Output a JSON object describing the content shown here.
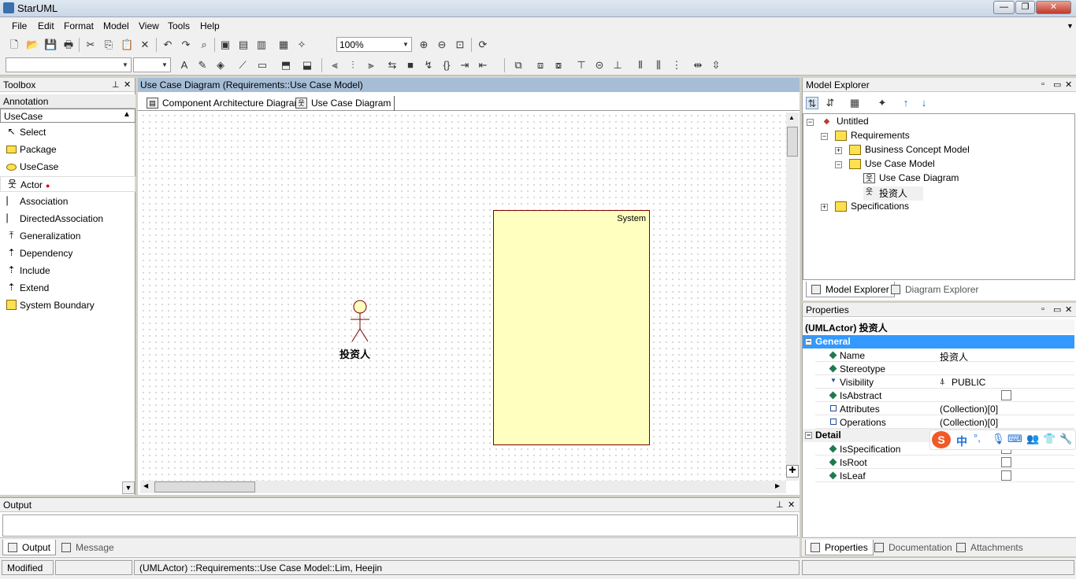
{
  "app": {
    "title": "StarUML"
  },
  "menu": [
    "File",
    "Edit",
    "Format",
    "Model",
    "View",
    "Tools",
    "Help"
  ],
  "toolbar": {
    "zoom": "100%"
  },
  "toolbox": {
    "title": "Toolbox",
    "categories": [
      "Annotation",
      "UseCase"
    ],
    "items": [
      "Select",
      "Package",
      "UseCase",
      "Actor",
      "Association",
      "DirectedAssociation",
      "Generalization",
      "Dependency",
      "Include",
      "Extend",
      "System Boundary"
    ]
  },
  "diagram": {
    "header": "Use Case Diagram (Requirements::Use Case Model)",
    "tabs": [
      "Component Architecture Diagram",
      "Use Case Diagram"
    ],
    "system_label": "System",
    "actor_name": "投资人"
  },
  "output": {
    "title": "Output",
    "tabs": [
      "Output",
      "Message"
    ]
  },
  "model_explorer": {
    "title": "Model Explorer",
    "tree": [
      "Untitled",
      "Requirements",
      "Business Concept Model",
      "Use Case Model",
      "Use Case Diagram",
      "投资人",
      "Specifications"
    ],
    "tabs": [
      "Model Explorer",
      "Diagram Explorer"
    ]
  },
  "properties": {
    "title": "Properties",
    "selection": "(UMLActor) 投资人",
    "general": "General",
    "detail": "Detail",
    "rows": [
      {
        "name": "Name",
        "value": "投资人"
      },
      {
        "name": "Stereotype",
        "value": ""
      },
      {
        "name": "Visibility",
        "value": "PUBLIC"
      },
      {
        "name": "IsAbstract",
        "value": ""
      },
      {
        "name": "Attributes",
        "value": "(Collection)[0]"
      },
      {
        "name": "Operations",
        "value": "(Collection)[0]"
      }
    ],
    "detail_rows": [
      "IsSpecification",
      "IsRoot",
      "IsLeaf"
    ],
    "tabs": [
      "Properties",
      "Documentation",
      "Attachments"
    ]
  },
  "ime": {
    "mode": "中"
  },
  "status": {
    "modified": "Modified",
    "path": "(UMLActor) ::Requirements::Use Case Model::Lim, Heejin"
  },
  "colors": {
    "diagram_header": "#a6bdd6",
    "system_fill": "#ffffc0",
    "selection_blue": "#3399ff"
  }
}
